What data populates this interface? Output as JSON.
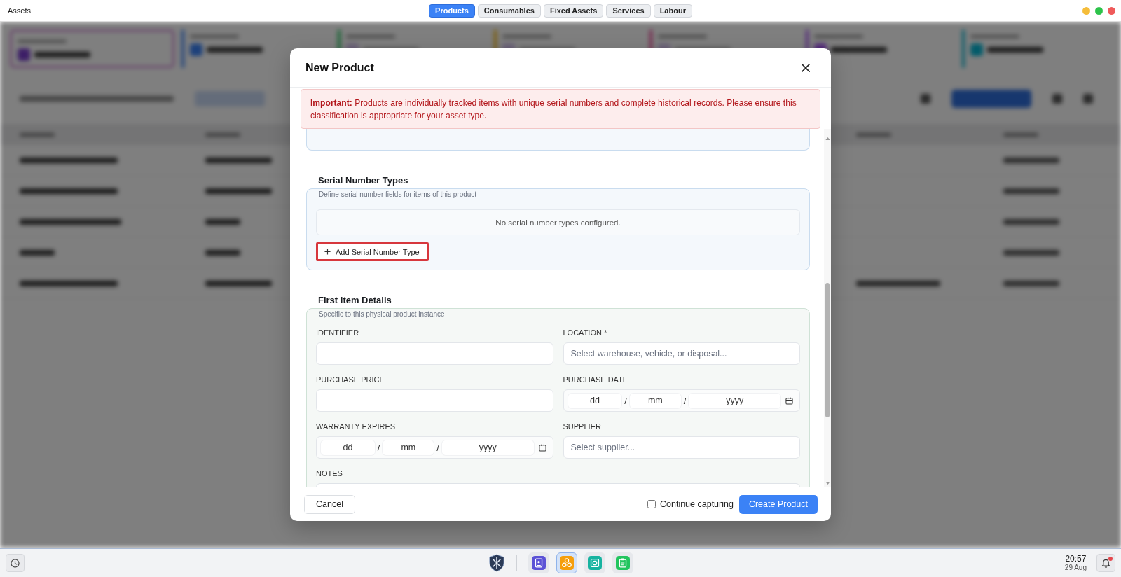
{
  "window": {
    "title": "Assets",
    "tabs": [
      {
        "label": "Products",
        "selected": true
      },
      {
        "label": "Consumables",
        "selected": false
      },
      {
        "label": "Fixed Assets",
        "selected": false
      },
      {
        "label": "Services",
        "selected": false
      },
      {
        "label": "Labour",
        "selected": false
      }
    ],
    "controls": [
      {
        "color": "#f5bd3a"
      },
      {
        "color": "#2cc34a"
      },
      {
        "color": "#ef5a5a"
      }
    ]
  },
  "modal": {
    "title": "New Product",
    "alert": "**Important:** Products are individually tracked items with unique serial numbers and complete historical records. Please ensure this classification is appropriate for your asset type.",
    "sections": [
      {
        "kind": "partial"
      },
      {
        "kind": "serials",
        "title": "Serial Number Types",
        "description": "Define serial number fields for items of this product",
        "empty_text": "No serial number types configured.",
        "add_button": {
          "label": "Add Serial Number Type",
          "highlighted": true
        }
      },
      {
        "kind": "fields",
        "title": "First Item Details",
        "description": "Specific to this physical product instance",
        "fields": [
          {
            "label": "IDENTIFIER",
            "kind": "text"
          },
          {
            "label": "LOCATION *",
            "kind": "text",
            "placeholder": "Select warehouse, vehicle, or disposal..."
          },
          {
            "label": "PURCHASE PRICE",
            "kind": "text"
          },
          {
            "label": "PURCHASE DATE",
            "kind": "date",
            "placeholders": [
              "dd",
              "mm",
              "yyyy"
            ],
            "separators": [
              "/",
              "/"
            ]
          },
          {
            "label": "WARRANTY EXPIRES",
            "kind": "date",
            "placeholders": [
              "dd",
              "mm",
              "yyyy"
            ],
            "separators": [
              "/",
              "/"
            ]
          },
          {
            "label": "SUPPLIER",
            "kind": "text",
            "placeholder": "Select supplier..."
          },
          {
            "label": "NOTES",
            "kind": "textarea"
          }
        ]
      }
    ],
    "footer": {
      "cancel": "Cancel",
      "checkbox": {
        "label": "Continue capturing",
        "checked": false
      },
      "submit": "Create Product"
    }
  },
  "taskbar": {
    "apps": [
      {
        "kind": "book",
        "color": "#5b52d6",
        "selected": false
      },
      {
        "kind": "nodes",
        "color": "#f59e0b",
        "selected": true
      },
      {
        "kind": "coin",
        "color": "#17b3a0",
        "selected": false
      },
      {
        "kind": "clipboard",
        "color": "#22c55e",
        "selected": false
      }
    ],
    "time": "20:57",
    "date": "29 Aug",
    "notifications": {
      "unread": true
    }
  }
}
